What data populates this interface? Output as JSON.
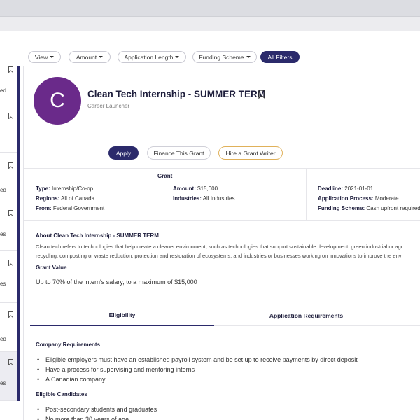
{
  "filters": [
    {
      "label": "View",
      "caret": true
    },
    {
      "label": "Amount",
      "caret": true
    },
    {
      "label": "Application Length",
      "caret": true
    },
    {
      "label": "Funding Scheme",
      "caret": true
    },
    {
      "label": "All Filters",
      "caret": false
    }
  ],
  "left_list": {
    "fragments": [
      "ed",
      "",
      "ed",
      "es",
      "es",
      "ed",
      "es"
    ]
  },
  "grant": {
    "avatar_letter": "C",
    "title": "Clean Tech Internship - SUMMER TERM",
    "organization": "Career Launcher",
    "actions": {
      "apply": "Apply",
      "finance": "Finance This Grant",
      "writer": "Hire a Grant Writer"
    }
  },
  "details": {
    "heading": "Grant",
    "type_label": "Type:",
    "type_value": "Internship/Co-op",
    "regions_label": "Regions:",
    "regions_value": "All of Canada",
    "from_label": "From:",
    "from_value": "Federal Government",
    "amount_label": "Amount:",
    "amount_value": "$15,000",
    "industries_label": "Industries:",
    "industries_value": "All Industries",
    "deadline_label": "Deadline:",
    "deadline_value": "2021-01-01",
    "process_label": "Application Process:",
    "process_value": "Moderate",
    "scheme_label": "Funding Scheme:",
    "scheme_value": "Cash upfront required"
  },
  "about": {
    "heading": "About Clean Tech Internship - SUMMER TERM",
    "line1": "Clean tech refers to technologies that help create a cleaner environment, such as technologies that support sustainable development, green industrial or agr",
    "line2": "recycling, composting or waste reduction, protection and restoration of ecosystems, and industries or businesses working on innovations to improve the envi"
  },
  "grant_value": {
    "heading": "Grant Value",
    "text": "Up to 70% of the intern's salary, to a maximum of $15,000"
  },
  "tabs": [
    "Eligibility",
    "Application Requirements"
  ],
  "eligibility": {
    "company_heading": "Company Requirements",
    "company_items": [
      "Eligible employers must have an established payroll system and be set up to receive payments by direct deposit",
      "Have a process for supervising and mentoring interns",
      "A Canadian company"
    ],
    "candidates_heading": "Eligible Candidates",
    "candidate_items": [
      "Post-secondary students and graduates",
      "No more than 30 years of age"
    ]
  },
  "colors": {
    "brand": "#2b2a6b",
    "avatar": "#6a2a8a",
    "writer_border": "#e0b15a"
  },
  "icons": [
    "bookmark-icon",
    "caret-down-icon"
  ]
}
